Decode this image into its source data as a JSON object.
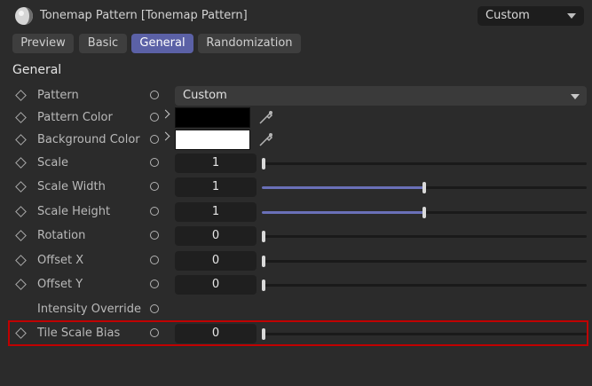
{
  "window": {
    "title": "Tonemap Pattern [Tonemap Pattern]",
    "preset_value": "Custom"
  },
  "tabs": [
    {
      "label": "Preview",
      "active": false
    },
    {
      "label": "Basic",
      "active": false
    },
    {
      "label": "General",
      "active": true
    },
    {
      "label": "Randomization",
      "active": false
    }
  ],
  "section_title": "General",
  "params": {
    "pattern": {
      "label": "Pattern",
      "value": "Custom"
    },
    "pattern_color": {
      "label": "Pattern Color",
      "color": "#000000"
    },
    "background_color": {
      "label": "Background Color",
      "color": "#ffffff"
    },
    "scale": {
      "label": "Scale",
      "value": "1",
      "slider_fraction": 0.0
    },
    "scale_width": {
      "label": "Scale Width",
      "value": "1",
      "slider_fraction": 0.5
    },
    "scale_height": {
      "label": "Scale Height",
      "value": "1",
      "slider_fraction": 0.5
    },
    "rotation": {
      "label": "Rotation",
      "value": "0",
      "slider_fraction": 0.0
    },
    "offset_x": {
      "label": "Offset X",
      "value": "0",
      "slider_fraction": 0.0
    },
    "offset_y": {
      "label": "Offset Y",
      "value": "0",
      "slider_fraction": 0.0
    },
    "intensity_override": {
      "label": "Intensity Override"
    },
    "tile_scale_bias": {
      "label": "Tile Scale Bias",
      "value": "0",
      "slider_fraction": 0.0,
      "highlighted": true
    }
  },
  "colors": {
    "accent": "#5b61a6",
    "highlight": "#c00000"
  }
}
